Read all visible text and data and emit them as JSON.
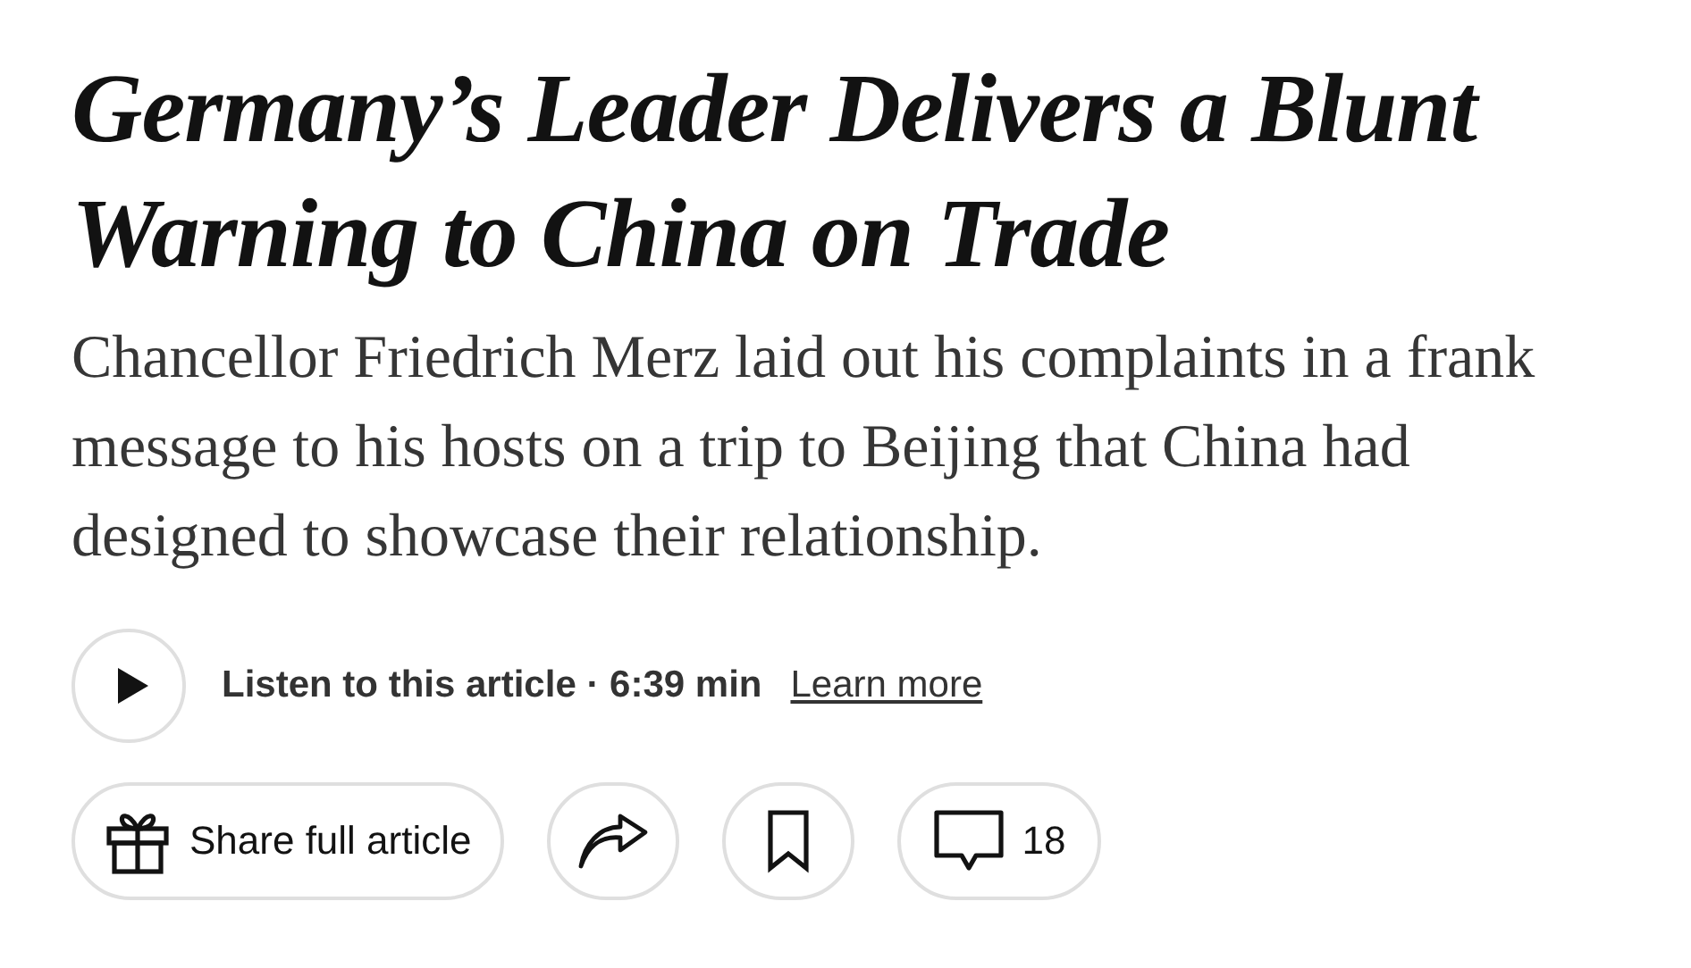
{
  "headline": "Germany’s Leader Delivers a Blunt Warning to China on Trade",
  "summary": "Chancellor Friedrich Merz laid out his complaints in a frank message to his hosts on a trip to Beijing that China had designed to showcase their relationship.",
  "audio": {
    "label": "Listen to this article · 6:39 min",
    "link": "Learn more"
  },
  "actions": [
    {
      "kind": "share-full",
      "label": "Share full article"
    },
    {
      "kind": "share"
    },
    {
      "kind": "save"
    },
    {
      "kind": "comments",
      "label": "18"
    }
  ]
}
